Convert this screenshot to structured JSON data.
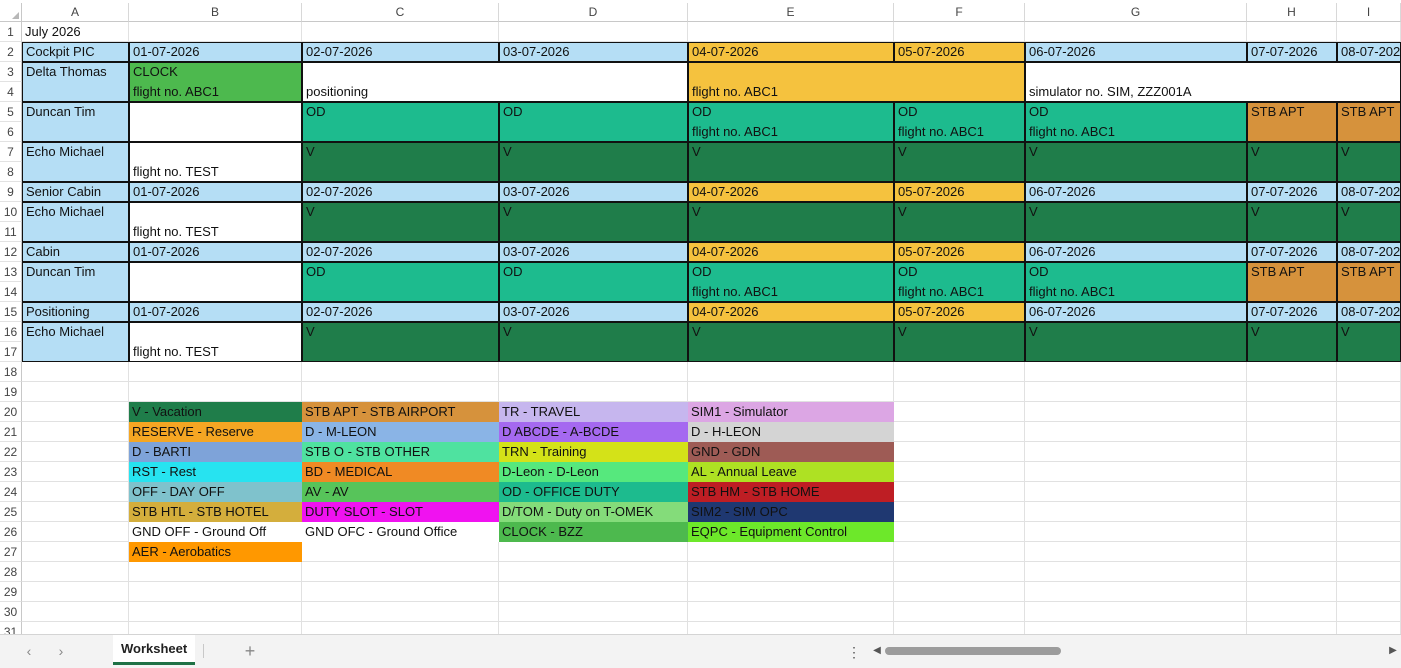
{
  "sheet": {
    "columns": [
      "A",
      "B",
      "C",
      "D",
      "E",
      "F",
      "G",
      "H",
      "I"
    ],
    "rows": [
      "1",
      "2",
      "3",
      "4",
      "5",
      "6",
      "7",
      "8",
      "9",
      "10",
      "11",
      "12",
      "13",
      "14",
      "15",
      "16",
      "17",
      "18",
      "19",
      "20",
      "21",
      "22",
      "23",
      "24",
      "25",
      "26",
      "27",
      "28",
      "29",
      "30",
      "31"
    ],
    "title": "July 2026",
    "dates": [
      "01-07-2026",
      "02-07-2026",
      "03-07-2026",
      "04-07-2026",
      "05-07-2026",
      "06-07-2026",
      "07-07-2026",
      "08-07-202"
    ],
    "sections": {
      "cockpit_pic": "Cockpit PIC",
      "senior_cabin": "Senior Cabin",
      "cabin": "Cabin",
      "positioning": "Positioning"
    },
    "crew": {
      "delta_thomas": "Delta Thomas",
      "duncan_tim": "Duncan Tim",
      "echo_michael": "Echo Michael"
    },
    "duties": {
      "clock": "CLOCK",
      "flight_abc1": "flight no. ABC1",
      "positioning": "positioning",
      "simulator": "simulator no. SIM, ZZZ001A",
      "od": "OD",
      "stb_apt": "STB APT",
      "v": "V",
      "flight_test": "flight no. TEST"
    },
    "legend": [
      "V - Vacation",
      "RESERVE - Reserve",
      "D - BARTI",
      "RST - Rest",
      "OFF - DAY OFF",
      "STB HTL - STB HOTEL",
      "GND OFF - Ground Off",
      "AER - Aerobatics",
      "STB APT - STB AIRPORT",
      "D - M-LEON",
      "STB O - STB OTHER",
      "BD - MEDICAL",
      "AV - AV",
      "DUTY SLOT - SLOT",
      "GND OFC - Ground Office",
      "TR - TRAVEL",
      "D ABCDE - A-BCDE",
      "TRN - Training",
      "D-Leon - D-Leon",
      "OD - OFFICE DUTY",
      "D/TOM - Duty on T-OMEK",
      "CLOCK - BZZ",
      "SIM1 - Simulator",
      "D - H-LEON",
      "GND - GDN",
      "AL - Annual Leave",
      "STB HM - STB HOME",
      "SIM2 - SIM OPC",
      "EQPC - Equipment Control"
    ],
    "colors": {
      "header_blue": "#b5def5",
      "weekend": "#f5c23e",
      "od_teal": "#1dbb8e",
      "vacation_green": "#1f7d4a",
      "stb_apt_orange": "#d6923c",
      "clock_green": "#4db94e",
      "orange_flight": "#f5c23e"
    }
  },
  "tabs": {
    "active": "Worksheet",
    "add_icon": "plus-icon",
    "prev_icon": "chevron-left-icon",
    "next_icon": "chevron-right-icon",
    "menu_icon": "vertical-dots-icon"
  }
}
